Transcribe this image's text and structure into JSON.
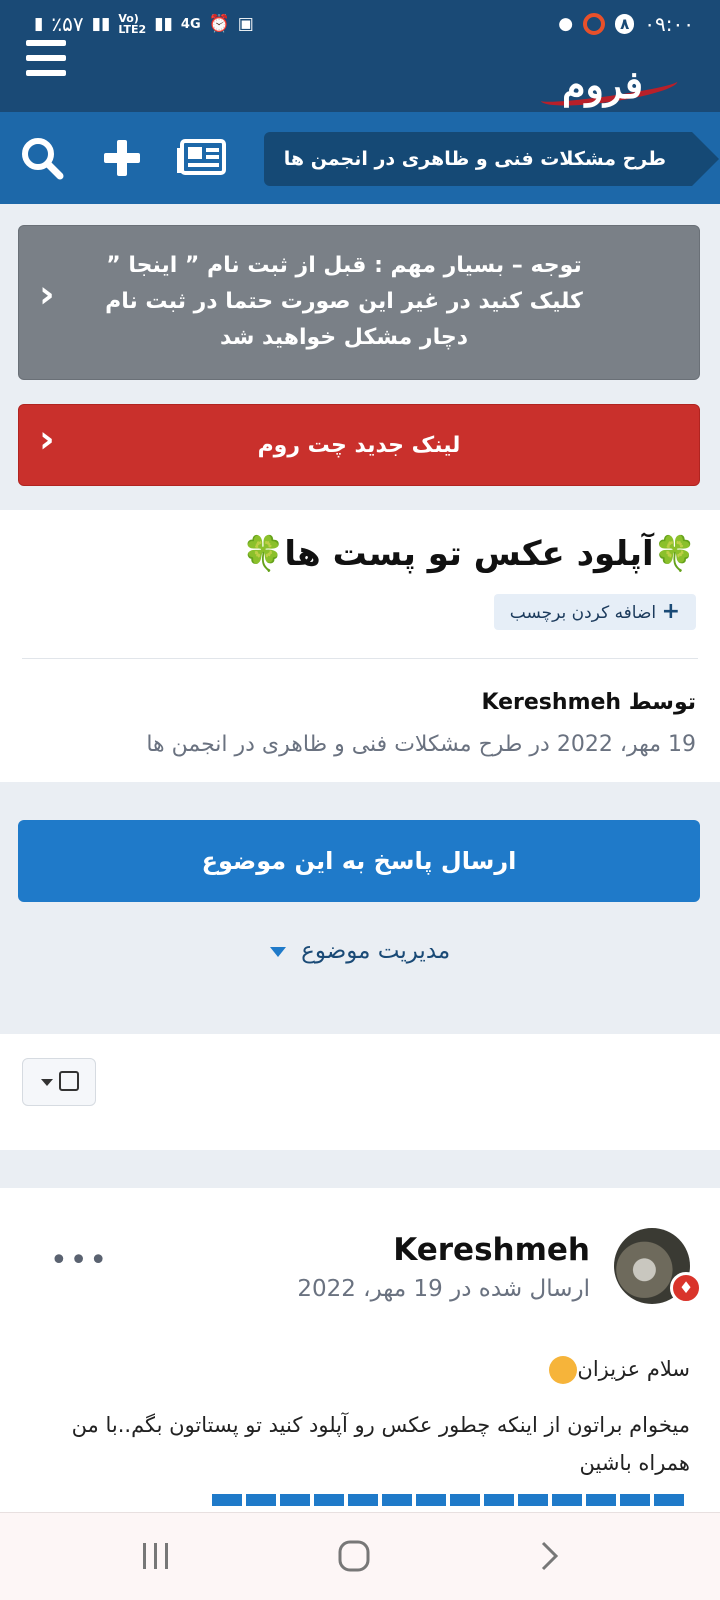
{
  "status_bar": {
    "battery": "٪۵۷",
    "net1": "Vo)\nLTE2",
    "net2": "4G",
    "time": "۰۹:۰۰",
    "notif_count": "۸"
  },
  "header": {
    "logo_text": "فروم"
  },
  "nav": {
    "breadcrumb": "طرح مشکلات فنی و ظاهری در انجمن ها"
  },
  "notices": {
    "important": "توجه – بسیار مهم : قبل از ثبت نام ” اینجا ” کلیک کنید در غیر این صورت حتما در ثبت نام دچار مشکل خواهید شد",
    "chatroom": "لینک جدید چت روم"
  },
  "topic": {
    "title": "🍀آپلود عکس تو پست ها🍀",
    "add_tag": "اضافه کردن برچسب",
    "by_prefix": "توسط",
    "author": "Kereshmeh",
    "meta": "19 مهر، 2022 در طرح مشکلات فنی و ظاهری در انجمن ها"
  },
  "actions": {
    "reply": "ارسال پاسخ به این موضوع",
    "manage": "مدیریت موضوع"
  },
  "post": {
    "author": "Kereshmeh",
    "posted": "ارسال شده در 19 مهر، 2022",
    "more": "•••",
    "line1": "سلام عزیزان",
    "line2": "میخوام براتون از اینکه چطور عکس رو آپلود کنید تو پستاتون بگم..با من همراه باشین"
  },
  "colors": {
    "header": "#1a4a76",
    "navbar": "#1d68a9",
    "reply_button": "#1f7ac9",
    "notice_gray": "#7a8087",
    "notice_red": "#c9302c"
  }
}
